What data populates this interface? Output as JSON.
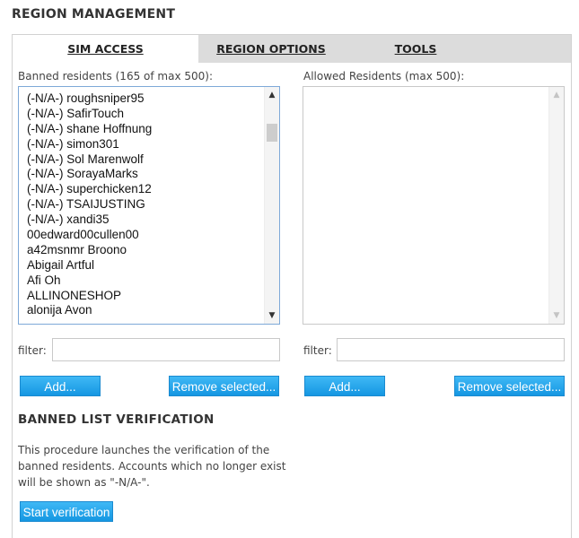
{
  "page_title": "REGION MANAGEMENT",
  "tabs": [
    {
      "label": "SIM ACCESS",
      "active": true
    },
    {
      "label": "REGION OPTIONS",
      "active": false
    },
    {
      "label": "TOOLS",
      "active": false
    }
  ],
  "banned": {
    "label": "Banned residents (165 of max 500):",
    "items": [
      "(-N/A-) roughsniper95",
      "(-N/A-) SafirTouch",
      "(-N/A-) shane Hoffnung",
      "(-N/A-) simon301",
      "(-N/A-) Sol Marenwolf",
      "(-N/A-) SorayaMarks",
      "(-N/A-) superchicken12",
      "(-N/A-) TSAIJUSTING",
      "(-N/A-) xandi35",
      "00edward00cullen00",
      "a42msnmr Broono",
      "Abigail Artful",
      "Afi Oh",
      "ALLINONESHOP",
      "alonija Avon"
    ],
    "filter_label": "filter:",
    "filter_value": "",
    "add_label": "Add...",
    "remove_label": "Remove selected..."
  },
  "allowed": {
    "label": "Allowed Residents (max 500):",
    "items": [],
    "filter_label": "filter:",
    "filter_value": "",
    "add_label": "Add...",
    "remove_label": "Remove selected..."
  },
  "verification": {
    "heading": "BANNED LIST VERIFICATION",
    "description": "This procedure launches the verification of the banned residents. Accounts which no longer exist will be shown as \"-N/A-\".",
    "button_label": "Start verification"
  },
  "icons": {
    "scroll_up": "arrow-up-icon",
    "scroll_down": "arrow-down-icon"
  },
  "colors": {
    "button_blue": "#1e9fe8",
    "tab_bar": "#dcdcdc",
    "focus_border": "#7ea9d8"
  }
}
